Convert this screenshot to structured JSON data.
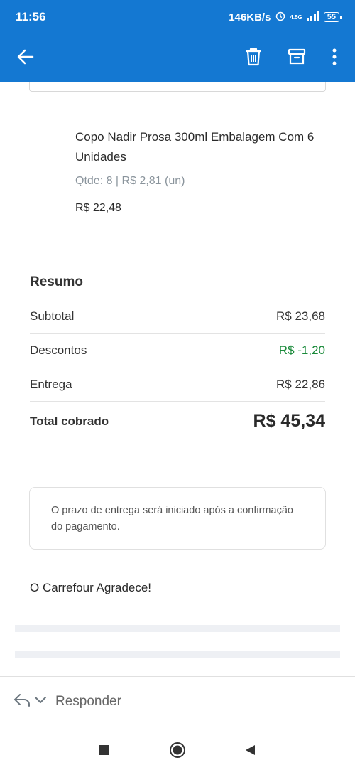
{
  "status_bar": {
    "time": "11:56",
    "speed": "146KB/s",
    "network": "4.5G",
    "battery": "55"
  },
  "appbar": {
    "icons": [
      "back-arrow-icon",
      "trash-icon",
      "archive-icon",
      "more-vert-icon"
    ]
  },
  "product": {
    "name": "Copo Nadir Prosa 300ml Embalagem Com 6 Unidades",
    "qty_price": "Qtde: 8 | R$ 2,81 (un)",
    "price": "R$ 22,48"
  },
  "summary": {
    "title": "Resumo",
    "subtotal_label": "Subtotal",
    "subtotal_value": "R$ 23,68",
    "discount_label": "Descontos",
    "discount_value": "R$ -1,20",
    "delivery_label": "Entrega",
    "delivery_value": "R$ 22,86",
    "total_label": "Total cobrado",
    "total_value": "R$ 45,34"
  },
  "notice": {
    "text": "O prazo de entrega será iniciado após a confirmação do pagamento."
  },
  "thanks": "O Carrefour Agradece!",
  "reply": {
    "label": "Responder"
  },
  "colors": {
    "brand": "#1478d2",
    "discount": "#1a8a3a",
    "muted": "#8a949c"
  }
}
